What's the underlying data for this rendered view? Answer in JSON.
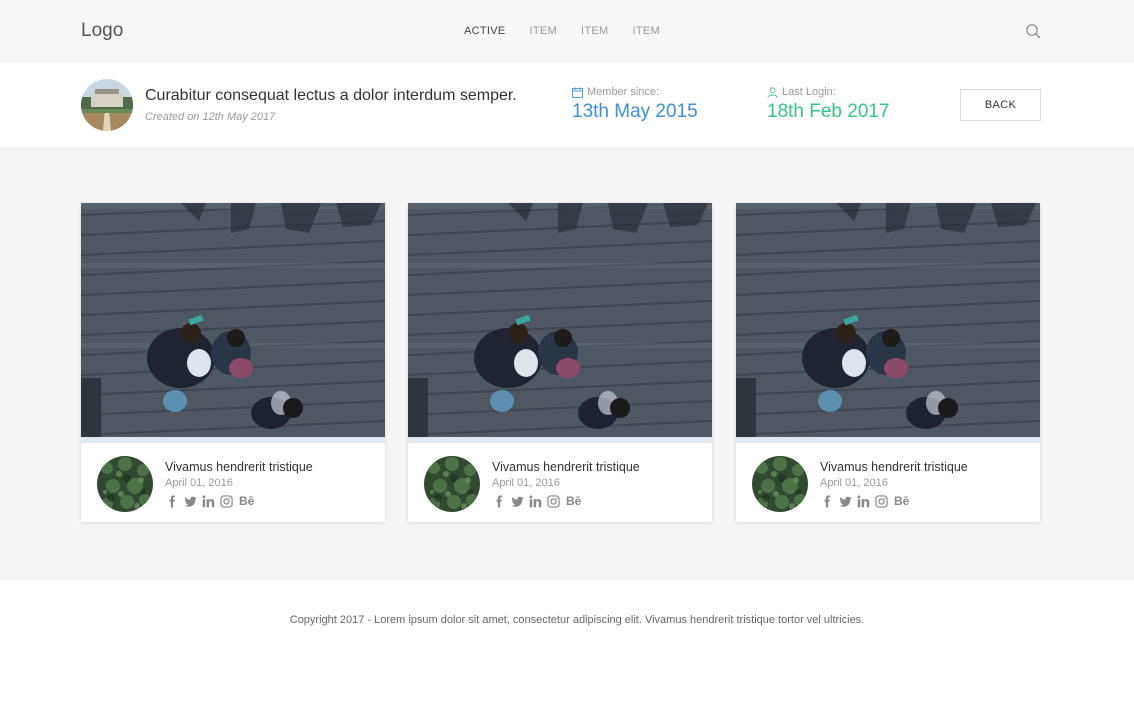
{
  "header": {
    "logo": "Logo",
    "nav": [
      {
        "label": "ACTIVE",
        "active": true
      },
      {
        "label": "ITEM",
        "active": false
      },
      {
        "label": "ITEM",
        "active": false
      },
      {
        "label": "ITEM",
        "active": false
      }
    ],
    "search_icon": "search-icon"
  },
  "profile": {
    "title": "Curabitur consequat lectus a dolor interdum semper.",
    "created": "Created on 12th May 2017",
    "member_since_label": "Member since:",
    "member_since_value": "13th May 2015",
    "last_login_label": "Last Login:",
    "last_login_value": "18th Feb 2017",
    "back_label": "BACK"
  },
  "cards": [
    {
      "title": "Vivamus hendrerit tristique",
      "date": "April 01, 2016",
      "behance": "Bē"
    },
    {
      "title": "Vivamus hendrerit tristique",
      "date": "April 01, 2016",
      "behance": "Bē"
    },
    {
      "title": "Vivamus hendrerit tristique",
      "date": "April 01, 2016",
      "behance": "Bē"
    }
  ],
  "footer": {
    "copyright": "Copyright 2017 - Lorem ipsum dolor sit amet, consectetur adipiscing elit. Vivamus hendrerit tristique tortor vel ultricies."
  },
  "colors": {
    "member_since": "#3d8fd6",
    "last_login": "#3ac28a",
    "topbar_bg": "#f7f7f7",
    "content_bg": "#f5f5f5"
  }
}
